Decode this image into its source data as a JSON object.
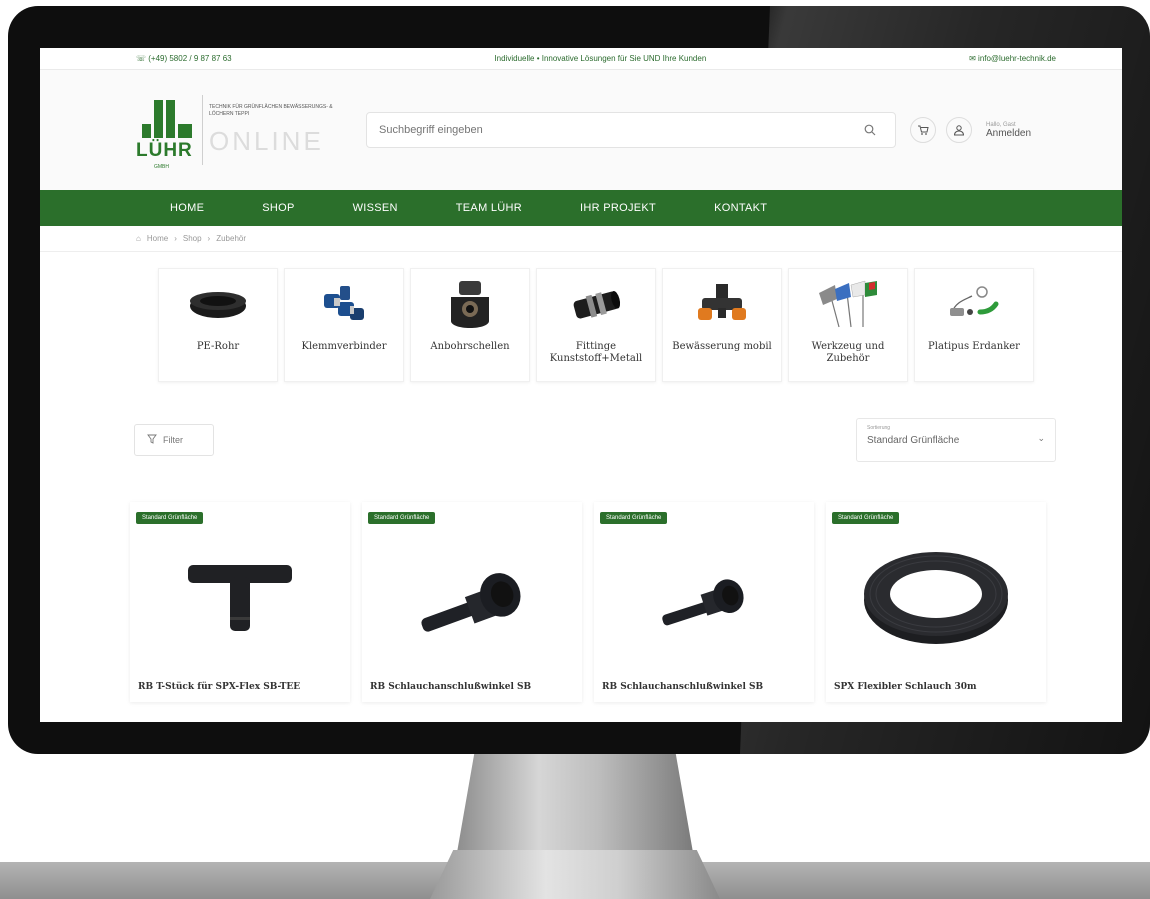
{
  "topbar": {
    "phone": "☏ (+49) 5802 / 9 87 87 63",
    "center": "Individuelle • Innovative Lösungen für Sie UND Ihre Kunden",
    "email": "✉ info@luehr-technik.de"
  },
  "logo": {
    "name": "LÜHR",
    "gmbh": "GMBH",
    "tagline": "TECHNIK FÜR GRÜNFLÄCHEN BEWÄSSERUNGS- & LÖCHERN TEPPI",
    "online": "ONLINE"
  },
  "search": {
    "placeholder": "Suchbegriff eingeben"
  },
  "account": {
    "greeting": "Hallo, Gast",
    "login": "Anmelden"
  },
  "nav": [
    "HOME",
    "SHOP",
    "WISSEN",
    "TEAM LÜHR",
    "IHR PROJEKT",
    "KONTAKT"
  ],
  "breadcrumb": [
    "Home",
    "Shop",
    "Zubehör"
  ],
  "categories": [
    {
      "label": "PE-Rohr",
      "icon": "pe-pipe-icon"
    },
    {
      "label": "Klemmverbinder",
      "icon": "clamp-connector-icon"
    },
    {
      "label": "Anbohrschellen",
      "icon": "tapping-saddle-icon"
    },
    {
      "label": "Fittinge Kunststoff+Metall",
      "icon": "fitting-icon"
    },
    {
      "label": "Bewässerung mobil",
      "icon": "mobile-irrigation-icon"
    },
    {
      "label": "Werkzeug und Zubehör",
      "icon": "tools-flags-icon"
    },
    {
      "label": "Platipus Erdanker",
      "icon": "earth-anchor-icon"
    }
  ],
  "filter": {
    "label": "Filter"
  },
  "sort": {
    "small_label": "Sortierung",
    "value": "Standard Grünfläche"
  },
  "products": [
    {
      "badge": "Standard Grünfläche",
      "title": "RB T-Stück für SPX-Flex SB-TEE",
      "icon": "t-piece-icon"
    },
    {
      "badge": "Standard Grünfläche",
      "title": "RB Schlauchanschlußwinkel SB",
      "icon": "elbow-icon"
    },
    {
      "badge": "Standard Grünfläche",
      "title": "RB Schlauchanschlußwinkel SB",
      "icon": "elbow-small-icon"
    },
    {
      "badge": "Standard Grünfläche",
      "title": "SPX Flexibler Schlauch 30m",
      "icon": "hose-coil-icon"
    }
  ],
  "colors": {
    "brand_green": "#2b6f2b",
    "frame": "#0e0e0e"
  }
}
